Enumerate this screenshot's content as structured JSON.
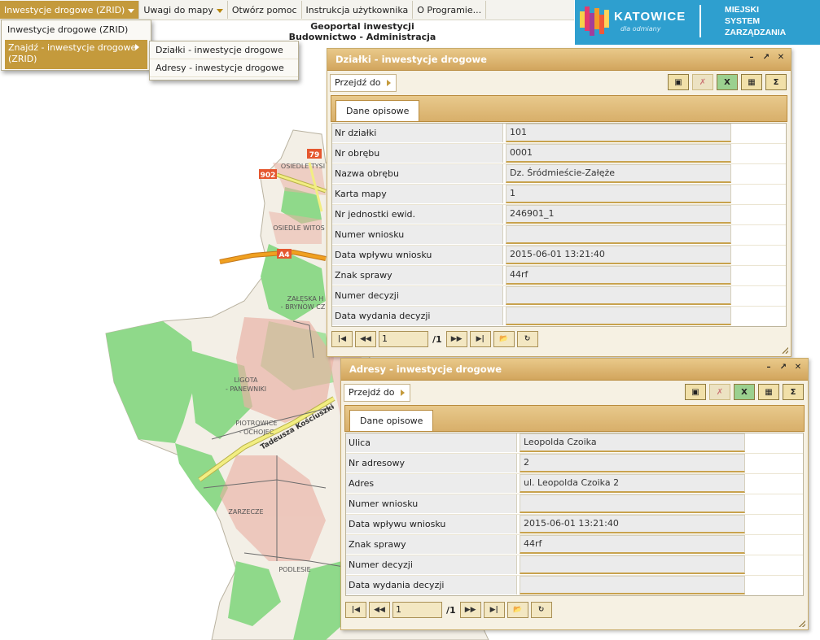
{
  "menu": {
    "items": [
      {
        "label": "Inwestycje drogowe (ZRID)",
        "has_caret": true,
        "active": true
      },
      {
        "label": "Uwagi do mapy",
        "has_caret": true
      },
      {
        "label": "Otwórz pomoc"
      },
      {
        "label": "Instrukcja użytkownika"
      },
      {
        "label": "O Programie..."
      }
    ]
  },
  "portal_title": {
    "line1": "Geoportal inwestycji",
    "line2": "Budownictwo - Administracja"
  },
  "logo": {
    "city": "KATOWICE",
    "tagline": "dla odmiany",
    "system_lines": [
      "MIEJSKI",
      "SYSTEM",
      "ZARZĄDZANIA"
    ],
    "bg_color": "#2e9fcf"
  },
  "dropdown_main": {
    "items": [
      "Inwestycje drogowe (ZRID)",
      "Znajdź - inwestycje drogowe (ZRID)"
    ]
  },
  "dropdown_sub": {
    "items": [
      "Działki - inwestycje drogowe",
      "Adresy - inwestycje drogowe"
    ]
  },
  "map_labels": {
    "road_79": "79",
    "road_902": "902",
    "road_a4": "A4",
    "osiedle_tysiaclecia": "OSIEDLE TYSI",
    "osiedle_witosa": "OSIEDLE WITOS",
    "zaleska_1": "ZAŁĘSKA H",
    "zaleska_2": "- BRYNÓW CZ",
    "ligota_1": "LIGOTA",
    "ligota_2": "- PANEWNIKI",
    "piotrowice_1": "PIOTROWICE",
    "piotrowice_2": "- OCHOJEC",
    "zarzecze": "ZARZECZE",
    "podlesie": "PODLESIE",
    "street": "Tadeusza Kościuszki"
  },
  "window_dzialki": {
    "title": "Działki - inwestycje drogowe",
    "goto_label": "Przejdź do",
    "tab_label": "Dane opisowe",
    "rows": [
      {
        "label": "Nr działki",
        "value": "101"
      },
      {
        "label": "Nr obrębu",
        "value": "0001"
      },
      {
        "label": "Nazwa obrębu",
        "value": "Dz. Śródmieście-Załęże"
      },
      {
        "label": "Karta mapy",
        "value": "1"
      },
      {
        "label": "Nr jednostki ewid.",
        "value": "246901_1"
      },
      {
        "label": "Numer wniosku",
        "value": ""
      },
      {
        "label": "Data wpływu wniosku",
        "value": "2015-06-01 13:21:40"
      },
      {
        "label": "Znak sprawy",
        "value": "44rf"
      },
      {
        "label": "Numer decyzji",
        "value": ""
      },
      {
        "label": "Data wydania decyzji",
        "value": ""
      }
    ],
    "pager": {
      "page": "1",
      "total": "/1"
    }
  },
  "window_adresy": {
    "title": "Adresy - inwestycje drogowe",
    "goto_label": "Przejdź do",
    "tab_label": "Dane opisowe",
    "rows": [
      {
        "label": "Ulica",
        "value": "Leopolda Czoika"
      },
      {
        "label": "Nr adresowy",
        "value": "2"
      },
      {
        "label": "Adres",
        "value": "ul. Leopolda Czoika 2"
      },
      {
        "label": "Numer wniosku",
        "value": ""
      },
      {
        "label": "Data wpływu wniosku",
        "value": "2015-06-01 13:21:40"
      },
      {
        "label": "Znak sprawy",
        "value": "44rf"
      },
      {
        "label": "Numer decyzji",
        "value": ""
      },
      {
        "label": "Data wydania decyzji",
        "value": ""
      }
    ],
    "pager": {
      "page": "1",
      "total": "/1"
    }
  },
  "colors": {
    "accent": "#c49a3c",
    "window_header": "#d2a55d",
    "map_green": "#8fd98a",
    "map_urban": "#e9b1a4",
    "road_orange": "#f0a020",
    "road_yellow": "#f2ee82"
  }
}
